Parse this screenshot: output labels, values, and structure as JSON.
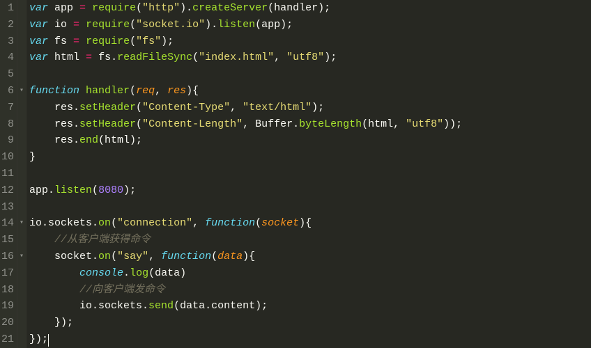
{
  "editor": {
    "lineCount": 21,
    "foldMarkers": {
      "6": "▾",
      "14": "▾",
      "16": "▾"
    },
    "lines": [
      [
        {
          "t": "var ",
          "c": "kw"
        },
        {
          "t": "app ",
          "c": "id"
        },
        {
          "t": "= ",
          "c": "op"
        },
        {
          "t": "require",
          "c": "fn"
        },
        {
          "t": "(",
          "c": "p"
        },
        {
          "t": "\"http\"",
          "c": "str"
        },
        {
          "t": ").",
          "c": "p"
        },
        {
          "t": "createServer",
          "c": "fn"
        },
        {
          "t": "(handler);",
          "c": "p"
        }
      ],
      [
        {
          "t": "var ",
          "c": "kw"
        },
        {
          "t": "io ",
          "c": "id"
        },
        {
          "t": "= ",
          "c": "op"
        },
        {
          "t": "require",
          "c": "fn"
        },
        {
          "t": "(",
          "c": "p"
        },
        {
          "t": "\"socket.io\"",
          "c": "str"
        },
        {
          "t": ").",
          "c": "p"
        },
        {
          "t": "listen",
          "c": "fn"
        },
        {
          "t": "(app);",
          "c": "p"
        }
      ],
      [
        {
          "t": "var ",
          "c": "kw"
        },
        {
          "t": "fs ",
          "c": "id"
        },
        {
          "t": "= ",
          "c": "op"
        },
        {
          "t": "require",
          "c": "fn"
        },
        {
          "t": "(",
          "c": "p"
        },
        {
          "t": "\"fs\"",
          "c": "str"
        },
        {
          "t": ");",
          "c": "p"
        }
      ],
      [
        {
          "t": "var ",
          "c": "kw"
        },
        {
          "t": "html ",
          "c": "id"
        },
        {
          "t": "= ",
          "c": "op"
        },
        {
          "t": "fs.",
          "c": "id"
        },
        {
          "t": "readFileSync",
          "c": "fn"
        },
        {
          "t": "(",
          "c": "p"
        },
        {
          "t": "\"index.html\"",
          "c": "str"
        },
        {
          "t": ", ",
          "c": "p"
        },
        {
          "t": "\"utf8\"",
          "c": "str"
        },
        {
          "t": ");",
          "c": "p"
        }
      ],
      [],
      [
        {
          "t": "function ",
          "c": "kw"
        },
        {
          "t": "handler",
          "c": "fn"
        },
        {
          "t": "(",
          "c": "p"
        },
        {
          "t": "req",
          "c": "arg"
        },
        {
          "t": ", ",
          "c": "p"
        },
        {
          "t": "res",
          "c": "arg"
        },
        {
          "t": "){",
          "c": "p"
        }
      ],
      [
        {
          "t": "    res.",
          "c": "id"
        },
        {
          "t": "setHeader",
          "c": "fn"
        },
        {
          "t": "(",
          "c": "p"
        },
        {
          "t": "\"Content-Type\"",
          "c": "str"
        },
        {
          "t": ", ",
          "c": "p"
        },
        {
          "t": "\"text/html\"",
          "c": "str"
        },
        {
          "t": ");",
          "c": "p"
        }
      ],
      [
        {
          "t": "    res.",
          "c": "id"
        },
        {
          "t": "setHeader",
          "c": "fn"
        },
        {
          "t": "(",
          "c": "p"
        },
        {
          "t": "\"Content-Length\"",
          "c": "str"
        },
        {
          "t": ", Buffer.",
          "c": "p"
        },
        {
          "t": "byteLength",
          "c": "fn"
        },
        {
          "t": "(html, ",
          "c": "p"
        },
        {
          "t": "\"utf8\"",
          "c": "str"
        },
        {
          "t": "));",
          "c": "p"
        }
      ],
      [
        {
          "t": "    res.",
          "c": "id"
        },
        {
          "t": "end",
          "c": "fn"
        },
        {
          "t": "(html);",
          "c": "p"
        }
      ],
      [
        {
          "t": "}",
          "c": "p"
        }
      ],
      [],
      [
        {
          "t": "app.",
          "c": "id"
        },
        {
          "t": "listen",
          "c": "fn"
        },
        {
          "t": "(",
          "c": "p"
        },
        {
          "t": "8080",
          "c": "num"
        },
        {
          "t": ");",
          "c": "p"
        }
      ],
      [],
      [
        {
          "t": "io.sockets.",
          "c": "id"
        },
        {
          "t": "on",
          "c": "fn"
        },
        {
          "t": "(",
          "c": "p"
        },
        {
          "t": "\"connection\"",
          "c": "str"
        },
        {
          "t": ", ",
          "c": "p"
        },
        {
          "t": "function",
          "c": "kw"
        },
        {
          "t": "(",
          "c": "p"
        },
        {
          "t": "socket",
          "c": "arg"
        },
        {
          "t": "){",
          "c": "p"
        }
      ],
      [
        {
          "t": "    ",
          "c": "p"
        },
        {
          "t": "//从客户端获得命令",
          "c": "cm"
        }
      ],
      [
        {
          "t": "    socket.",
          "c": "id"
        },
        {
          "t": "on",
          "c": "fn"
        },
        {
          "t": "(",
          "c": "p"
        },
        {
          "t": "\"say\"",
          "c": "str"
        },
        {
          "t": ", ",
          "c": "p"
        },
        {
          "t": "function",
          "c": "kw"
        },
        {
          "t": "(",
          "c": "p"
        },
        {
          "t": "data",
          "c": "arg"
        },
        {
          "t": "){",
          "c": "p"
        }
      ],
      [
        {
          "t": "        ",
          "c": "p"
        },
        {
          "t": "console",
          "c": "kw"
        },
        {
          "t": ".",
          "c": "p"
        },
        {
          "t": "log",
          "c": "fn"
        },
        {
          "t": "(data)",
          "c": "p"
        }
      ],
      [
        {
          "t": "        ",
          "c": "p"
        },
        {
          "t": "//向客户端发命令",
          "c": "cm"
        }
      ],
      [
        {
          "t": "        io.sockets.",
          "c": "id"
        },
        {
          "t": "send",
          "c": "fn"
        },
        {
          "t": "(data.content);",
          "c": "p"
        }
      ],
      [
        {
          "t": "    });",
          "c": "p"
        }
      ],
      [
        {
          "t": "});",
          "c": "p"
        },
        {
          "t": "CURSOR",
          "c": "cursor"
        }
      ]
    ]
  }
}
